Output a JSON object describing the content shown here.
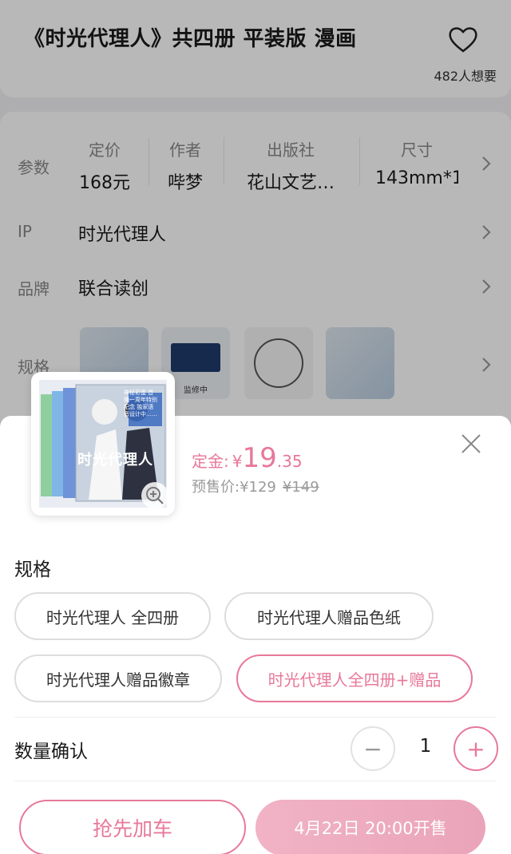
{
  "product": {
    "title": "《时光代理人》共四册 平装版 漫画",
    "want_count": "482人想要"
  },
  "params": {
    "row_label": "参数",
    "columns": [
      {
        "header": "定价",
        "value": "168元"
      },
      {
        "header": "作者",
        "value": "哔梦"
      },
      {
        "header": "出版社",
        "value": "花山文艺…"
      },
      {
        "header": "尺寸",
        "value": "143mm*1"
      }
    ]
  },
  "ip_row": {
    "label": "IP",
    "value": "时光代理人"
  },
  "brand_row": {
    "label": "品牌",
    "value": "联合读创"
  },
  "spec_row": {
    "label": "规格",
    "thumb_caption": "监修中"
  },
  "sheet": {
    "deposit_label": "定金:",
    "deposit_currency": "¥",
    "deposit_int": "19",
    "deposit_dec": ".35",
    "presale_label": "预售价:",
    "presale_price": "¥129",
    "original_price": "¥149",
    "cover_title": "时光代理人",
    "cover_note": "神秘彩蛋 首播一周年特别纪念 独家语音设计中……",
    "spec_title": "规格",
    "options": [
      {
        "label": "时光代理人 全四册",
        "selected": false
      },
      {
        "label": "时光代理人赠品色纸",
        "selected": false
      },
      {
        "label": "时光代理人赠品徽章",
        "selected": false
      },
      {
        "label": "时光代理人全四册+赠品",
        "selected": true
      }
    ],
    "quantity_label": "数量确认",
    "quantity": "1",
    "minus_symbol": "−",
    "plus_symbol": "+",
    "add_to_cart": "抢先加车",
    "sale_time": "4月22日 20:00开售"
  },
  "colors": {
    "accent": "#e8789a",
    "accent_light": "#f1b3c5",
    "overlay": "rgba(0,0,0,0.28)"
  }
}
